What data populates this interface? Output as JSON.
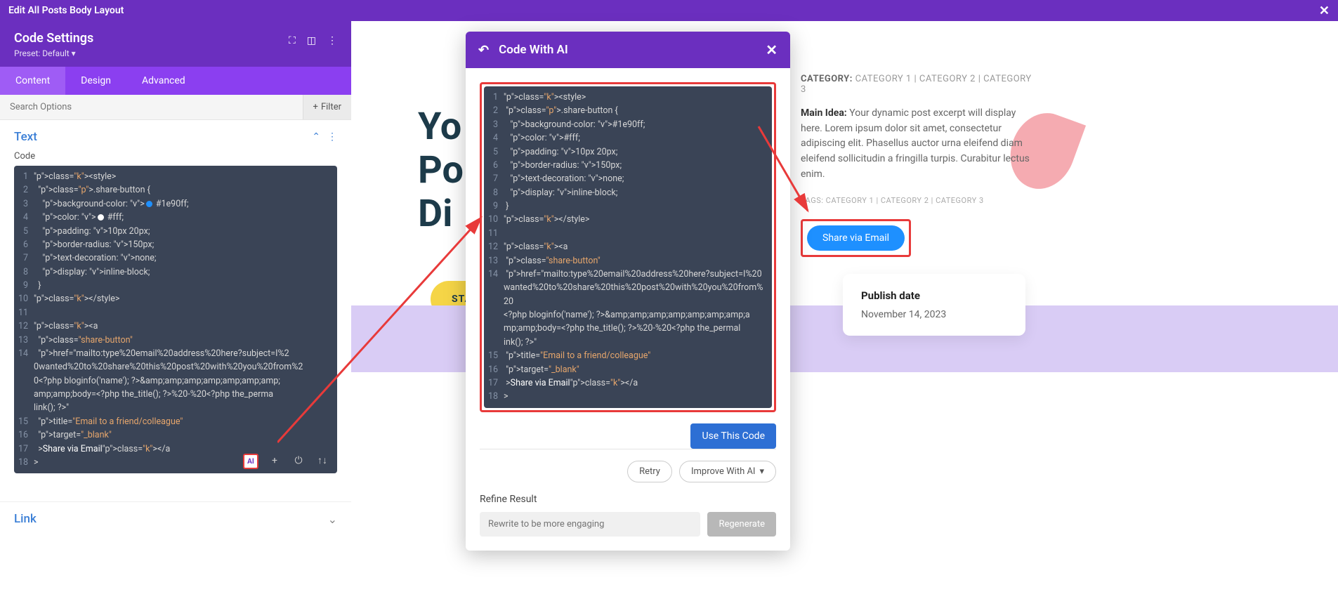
{
  "topbar": {
    "title": "Edit All Posts Body Layout"
  },
  "settings": {
    "title": "Code Settings",
    "preset_label": "Preset:",
    "preset_value": "Default"
  },
  "tabs": {
    "content": "Content",
    "design": "Design",
    "advanced": "Advanced"
  },
  "search": {
    "placeholder": "Search Options",
    "filter": "Filter"
  },
  "text_section": {
    "title": "Text",
    "code_label": "Code"
  },
  "link_section": {
    "title": "Link"
  },
  "code_lines": [
    "<style>",
    "  .share-button {",
    "    background-color: #1e90ff;",
    "    color: #fff;",
    "    padding: 10px 20px;",
    "    border-radius: 150px;",
    "    text-decoration: none;",
    "    display: inline-block;",
    "  }",
    "</style>",
    "",
    "<a",
    "  class=\"share-button\"",
    "  href=\"mailto:type%20email%20address%20here?subject=I%20wanted%20to%20share%20this%20post%20with%20you%20from%20<?php bloginfo('name'); ?>&amp;amp;amp;amp;amp;amp;amp;amp;amp;body=<?php the_title(); ?>%20-%20<?php the_permalink(); ?>\"",
    "  title=\"Email to a friend/colleague\"",
    "  target=\"_blank\"",
    "  >Share via Email</a",
    ">"
  ],
  "modal": {
    "title": "Code With AI",
    "use_btn": "Use This Code",
    "retry": "Retry",
    "improve": "Improve With AI",
    "refine_label": "Refine Result",
    "refine_placeholder": "Rewrite to be more engaging",
    "regenerate": "Regenerate"
  },
  "modal_code_lines": [
    "<style>",
    " .share-button {",
    "   background-color: #1e90ff;",
    "   color: #fff;",
    "   padding: 10px 20px;",
    "   border-radius: 150px;",
    "   text-decoration: none;",
    "   display: inline-block;",
    " }",
    "</style>",
    "",
    "<a",
    " class=\"share-button\"",
    " href=\"mailto:type%20email%20address%20here?subject=I%20wanted%20to%20share%20this%20post%20with%20you%20from%20<?php bloginfo('name'); ?>&amp;amp;amp;amp;amp;amp;amp;amp;amp;body=<?php the_title(); ?>%20-%20<?php the_permalink(); ?>\"",
    " title=\"Email to a friend/colleague\"",
    " target=\"_blank\"",
    " >Share via Email</a",
    ">"
  ],
  "preview": {
    "hero1": "Yo",
    "hero2": "Po",
    "hero3": "Di",
    "cta": "START R",
    "cat_label": "CATEGORY:",
    "cat_vals": "CATEGORY 1 | CATEGORY 2 | CATEGORY 3",
    "idea_label": "Main Idea:",
    "idea_text": "Your dynamic post excerpt will display here. Lorem ipsum dolor sit amet, consectetur adipiscing elit. Phasellus auctor urna eleifend diam eleifend sollicitudin a fringilla turpis. Curabitur lectus enim.",
    "tags": "TAGS: CATEGORY 1 | CATEGORY 2 | CATEGORY 3",
    "share_btn": "Share via Email",
    "publish_title": "Publish date",
    "publish_date": "November 14, 2023"
  }
}
